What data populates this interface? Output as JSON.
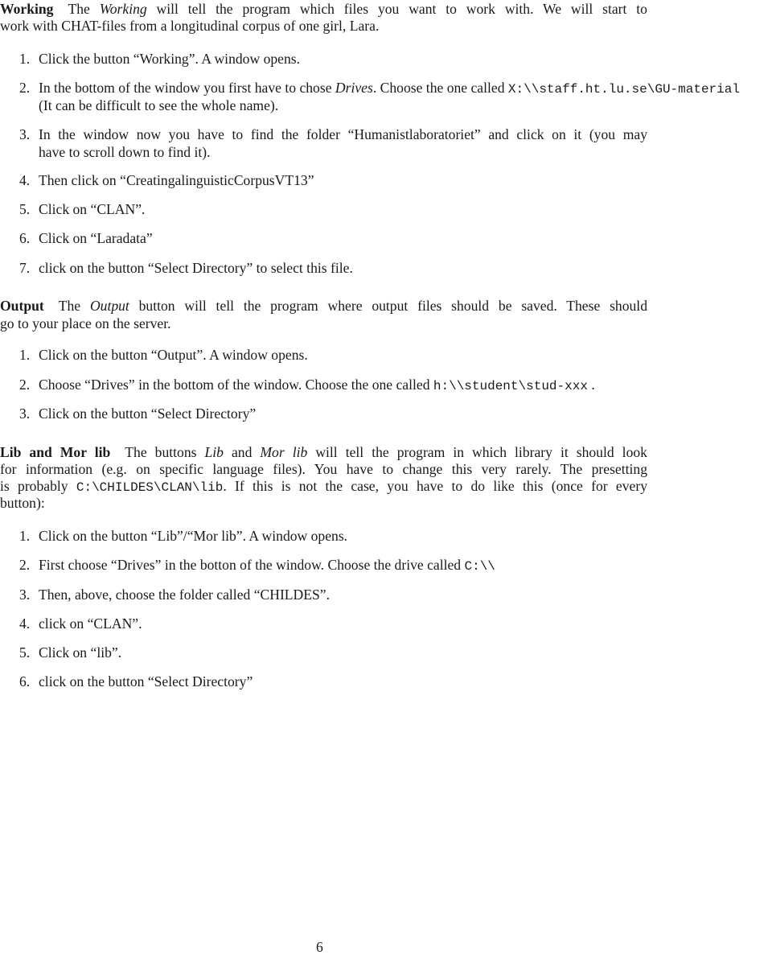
{
  "sections": {
    "working": {
      "heading": "Working",
      "intro_pre": "The ",
      "intro_em": "Working",
      "intro_line1_rest": " will tell the program which files you want to work with.  We will start to",
      "intro_line2": "work with CHAT-files from a longitudinal corpus of one girl, Lara.",
      "steps": [
        {
          "num": "1.",
          "text": "Click the button “Working”. A window opens."
        },
        {
          "num": "2.",
          "text_pre": "In the bottom of the window you first have to chose ",
          "text_em": "Drives",
          "text_mid": ". Choose the one called ",
          "code": "X:\\\\staff.ht.lu.se\\GU-material",
          "text_line2": "(It can be difficult to see the whole name)."
        },
        {
          "num": "3.",
          "text_line1": "In the window now you have to find the folder “Humanistlaboratoriet” and click on it (you may",
          "text_line2": "have to scroll down to find it)."
        },
        {
          "num": "4.",
          "text": "Then click on “CreatingalinguisticCorpusVT13”"
        },
        {
          "num": "5.",
          "text": "Click on “CLAN”."
        },
        {
          "num": "6.",
          "text": "Click on “Laradata”"
        },
        {
          "num": "7.",
          "text": "click on the button “Select Directory” to select this file."
        }
      ]
    },
    "output": {
      "heading": "Output",
      "intro_pre": "The ",
      "intro_em": "Output",
      "intro_line1_rest": " button will tell the program where output files should be saved. These should",
      "intro_line2": "go to your place on the server.",
      "steps": [
        {
          "num": "1.",
          "text": "Click on the button “Output”. A window opens."
        },
        {
          "num": "2.",
          "text_pre": "Choose “Drives” in the bottom of the window. Choose the one called ",
          "code": "h:\\\\student\\stud-xxx",
          "text_post": " ."
        },
        {
          "num": "3.",
          "text": "Click on the button “Select Directory”"
        }
      ]
    },
    "lib": {
      "heading": "Lib and Mor lib",
      "intro_pre": "The buttons ",
      "intro_em1": "Lib",
      "intro_and": " and ",
      "intro_em2": "Mor lib",
      "intro_line1_rest": " will tell the program in which library it should look",
      "intro_line2": "for information (e.g. on specific language files). You have to change this very rarely. The presetting",
      "intro_line3_pre": "is probably ",
      "intro_line3_code": "C:\\CHILDES\\CLAN\\lib",
      "intro_line3_rest": ". If this is not the case, you have to do like this (once for every",
      "intro_line4": "button):",
      "steps": [
        {
          "num": "1.",
          "text": "Click on the button “Lib”/“Mor lib”. A window opens."
        },
        {
          "num": "2.",
          "text_pre": "First choose “Drives” in the botton of the window. Choose the drive called ",
          "code": "C:\\\\"
        },
        {
          "num": "3.",
          "text": "Then, above, choose the folder called “CHILDES”."
        },
        {
          "num": "4.",
          "text": "click on “CLAN”."
        },
        {
          "num": "5.",
          "text": "Click on “lib”."
        },
        {
          "num": "6.",
          "text": "click on the button “Select Directory”"
        }
      ]
    }
  },
  "footer": {
    "page_number": "6"
  }
}
